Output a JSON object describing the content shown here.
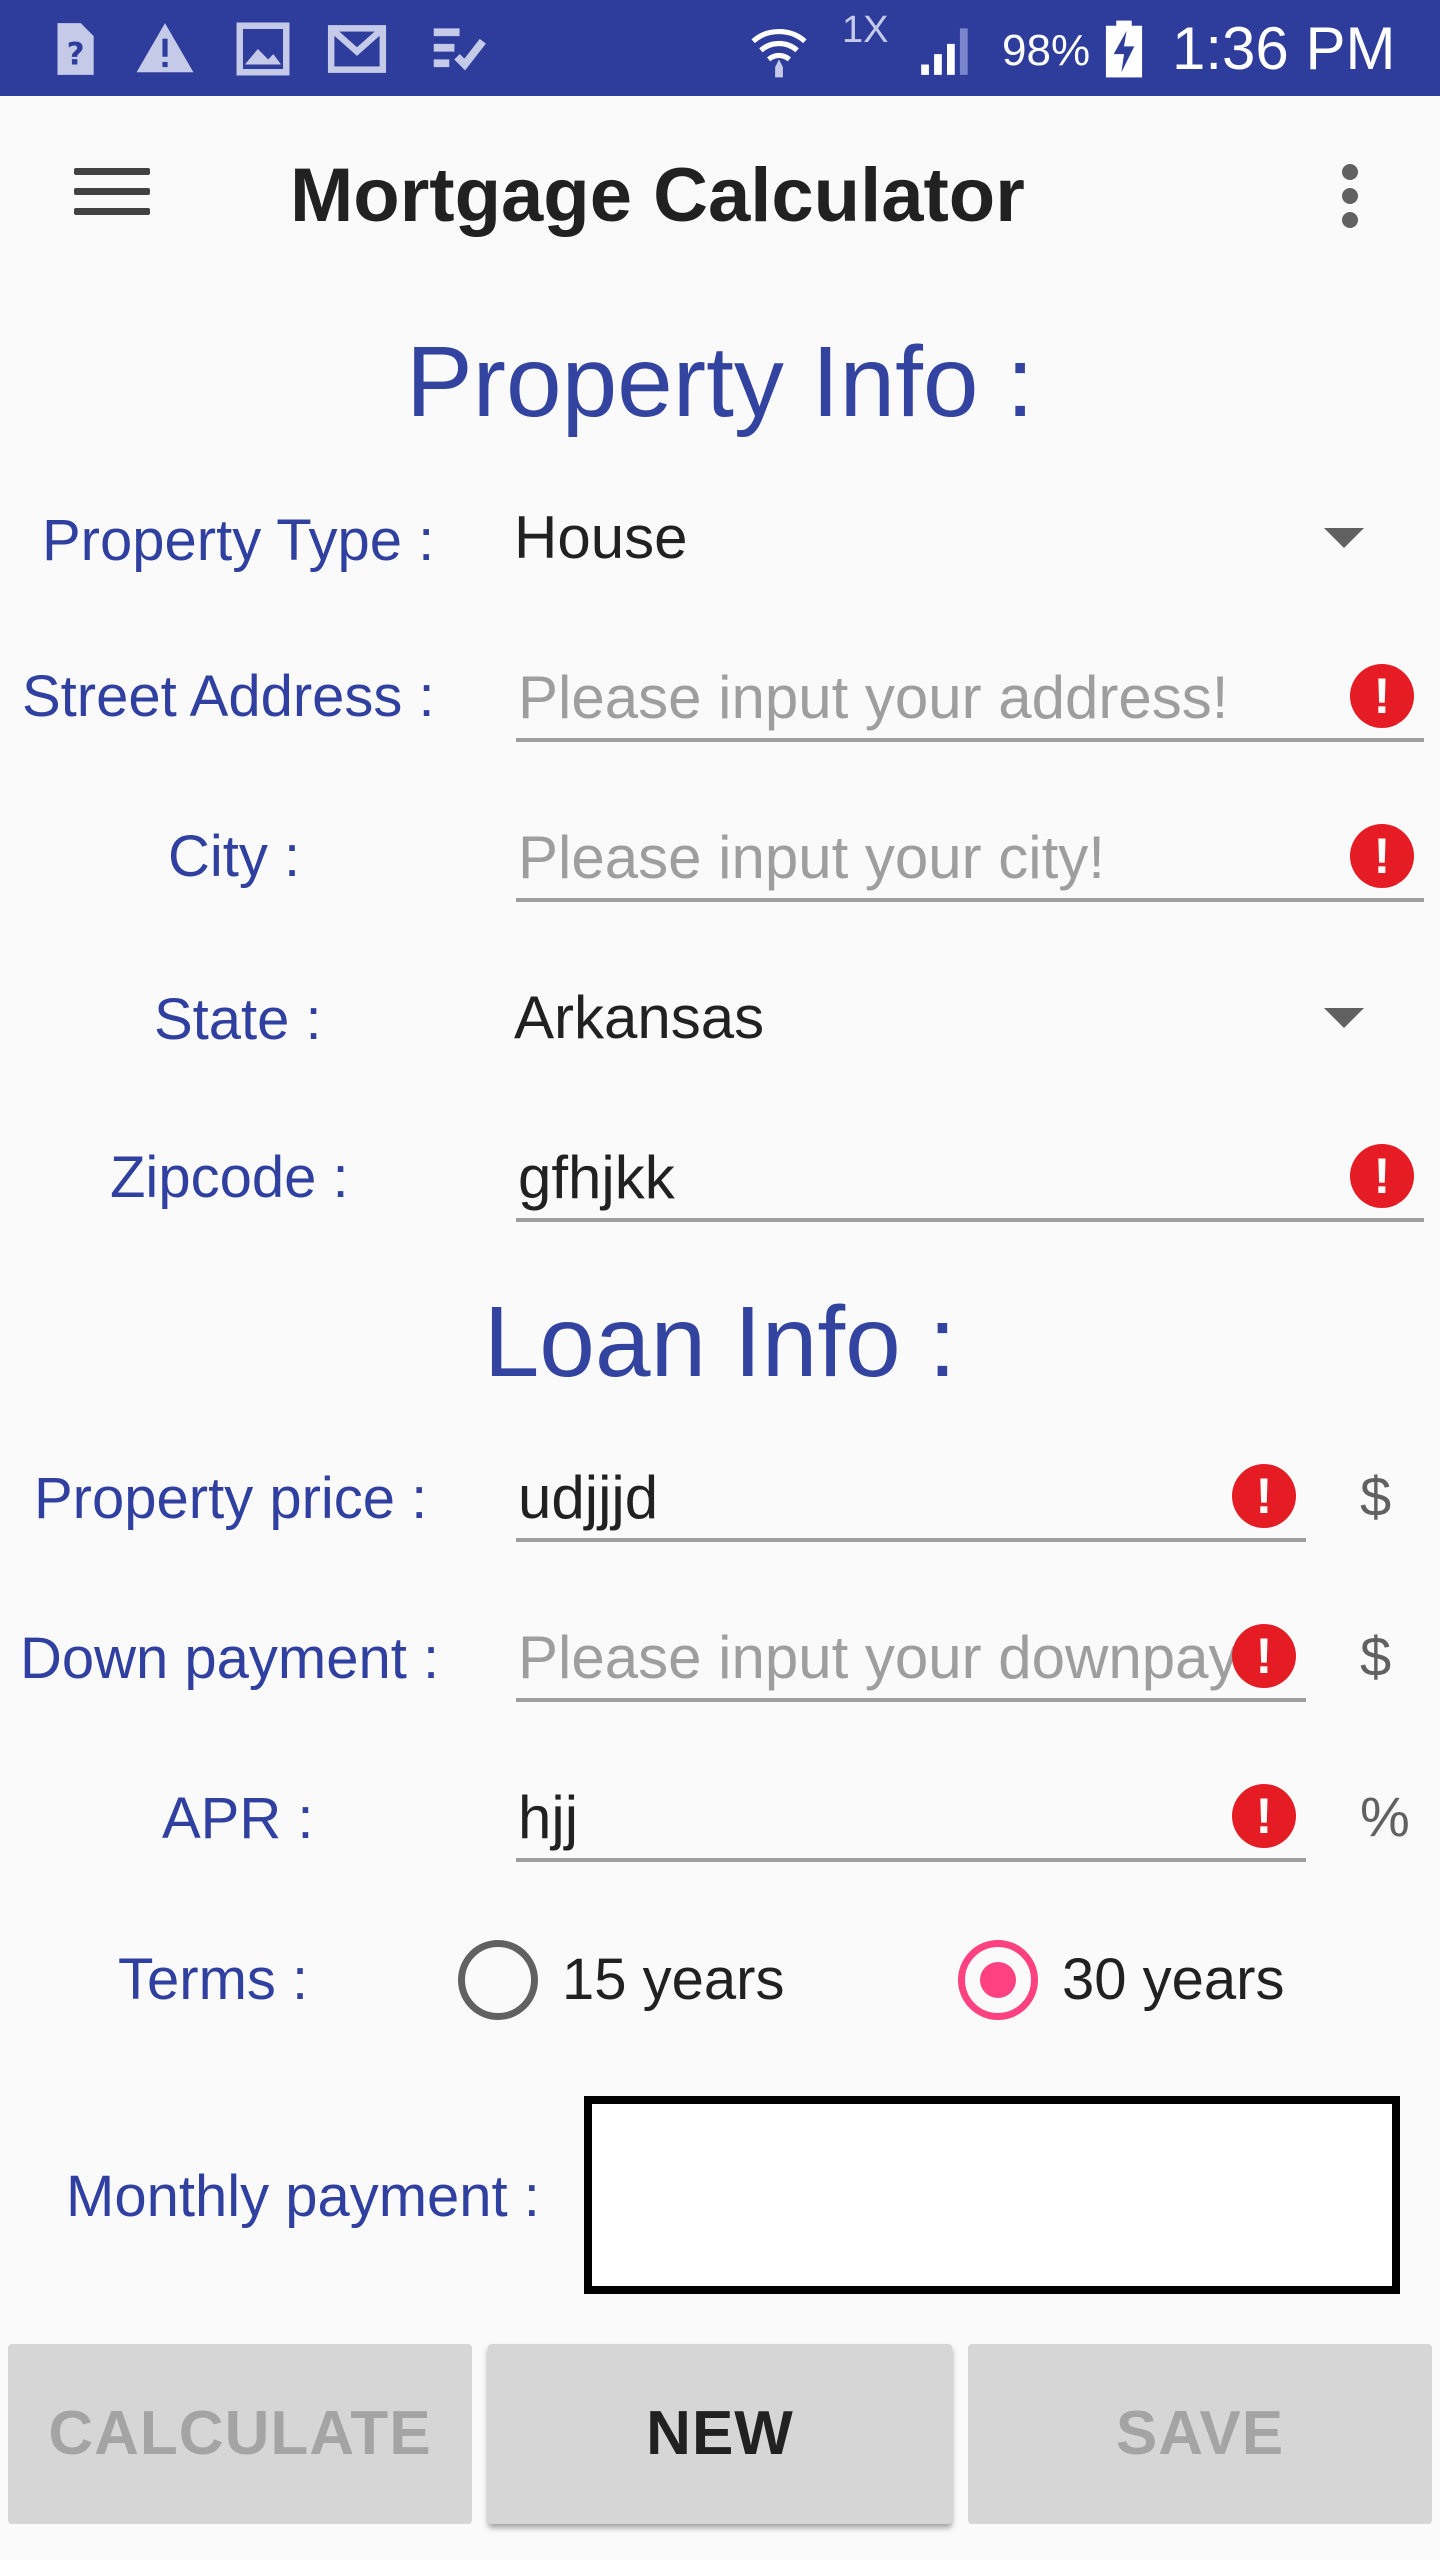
{
  "status_bar": {
    "icons": [
      "help-icon",
      "warning-icon",
      "image-icon",
      "gmail-icon",
      "task-check-icon",
      "wifi-icon",
      "signal-icon",
      "battery-charging-icon"
    ],
    "speed_label": "1X",
    "battery_percent": "98%",
    "time": "1:36 PM",
    "background_color": "#2e3d9c"
  },
  "app_bar": {
    "title": "Mortgage Calculator",
    "menu_icon": "hamburger-menu-icon",
    "overflow_icon": "more-vert-icon"
  },
  "property_info": {
    "heading": "Property Info :",
    "property_type": {
      "label": "Property Type :",
      "value": "House"
    },
    "street_address": {
      "label": "Street Address :",
      "placeholder": "Please input your address!"
    },
    "city": {
      "label": "City :",
      "placeholder": "Please input your city!"
    },
    "state": {
      "label": "State :",
      "value": "Arkansas"
    },
    "zipcode": {
      "label": "Zipcode :",
      "value": "gfhjkk"
    }
  },
  "loan_info": {
    "heading": "Loan Info :",
    "property_price": {
      "label": "Property price :",
      "value": "udjjjd",
      "unit": "$"
    },
    "down_payment": {
      "label": "Down payment :",
      "placeholder": "Please input your downpay",
      "unit": "$"
    },
    "apr": {
      "label": "APR :",
      "value": "hjj",
      "unit": "%"
    },
    "terms": {
      "label": "Terms :",
      "options": [
        {
          "label": "15 years",
          "checked": false
        },
        {
          "label": "30 years",
          "checked": true
        }
      ]
    },
    "monthly_payment": {
      "label": "Monthly payment :",
      "value": ""
    }
  },
  "error_mark": "!",
  "buttons": {
    "calculate": "CALCULATE",
    "new": "NEW",
    "save": "SAVE"
  },
  "colors": {
    "accent": "#ff4081",
    "label": "#3040a0",
    "error": "#e51c23"
  }
}
